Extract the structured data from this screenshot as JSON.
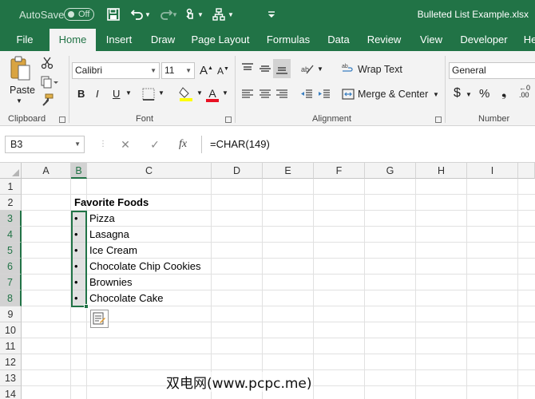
{
  "titlebar": {
    "autosave_label": "AutoSave",
    "autosave_state": "Off",
    "document_title": "Bulleted List Example.xlsx",
    "icons": [
      "save-icon",
      "undo-icon",
      "redo-icon",
      "touch-mode-icon",
      "shapes-icon",
      "customize-qat-icon"
    ]
  },
  "tabs": [
    "File",
    "Home",
    "Insert",
    "Draw",
    "Page Layout",
    "Formulas",
    "Data",
    "Review",
    "View",
    "Developer",
    "He"
  ],
  "active_tab": "Home",
  "ribbon": {
    "clipboard": {
      "label": "Clipboard",
      "paste_label": "Paste"
    },
    "font": {
      "label": "Font",
      "font_name": "Calibri",
      "font_size": "11",
      "bold": "B",
      "italic": "I",
      "underline": "U",
      "font_color": "A"
    },
    "alignment": {
      "label": "Alignment",
      "wrap_text": "Wrap Text",
      "merge_center": "Merge & Center"
    },
    "number": {
      "label": "Number",
      "format": "General",
      "currency": "$",
      "percent": "%"
    }
  },
  "formula_bar": {
    "name_box": "B3",
    "fx_label": "fx",
    "formula": "=CHAR(149)"
  },
  "grid": {
    "columns": [
      "A",
      "B",
      "C",
      "D",
      "E",
      "F",
      "G",
      "H",
      "I"
    ],
    "rows": [
      "1",
      "2",
      "3",
      "4",
      "5",
      "6",
      "7",
      "8",
      "9",
      "10",
      "11",
      "12",
      "13",
      "14"
    ],
    "selected_column": "B",
    "selected_rows": [
      "3",
      "4",
      "5",
      "6",
      "7",
      "8"
    ],
    "cells": {
      "C2": "Favorite Foods",
      "B3": "•",
      "C3": "Pizza",
      "B4": "•",
      "C4": "Lasagna",
      "B5": "•",
      "C5": "Ice Cream",
      "B6": "•",
      "C6": "Chocolate Chip Cookies",
      "B7": "•",
      "C7": "Brownies",
      "B8": "•",
      "C8": "Chocolate Cake"
    }
  },
  "watermark": "双电网(www.pcpc.me)",
  "colors": {
    "excel_green": "#217346",
    "ribbon_bg": "#f3f3f3",
    "selection_fill": "#c8c8c8"
  }
}
